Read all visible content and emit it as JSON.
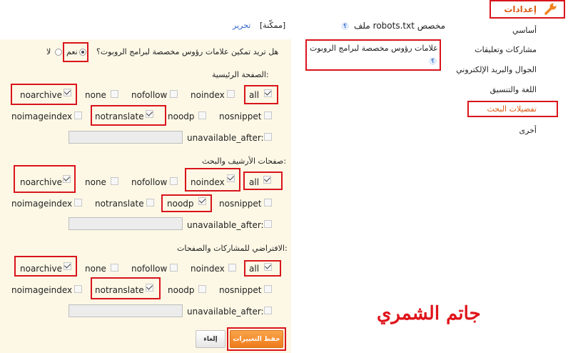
{
  "sidebar": {
    "items": [
      {
        "label": "إعدادات"
      },
      {
        "label": "أساسي"
      },
      {
        "label": "مشاركات وتعليقات"
      },
      {
        "label": "الجوال والبريد الإلكتروني"
      },
      {
        "label": "اللغة والتنسيق"
      },
      {
        "label": "تفضيلات البحث"
      },
      {
        "label": "أخرى"
      }
    ]
  },
  "robots_txt": {
    "title": "ملف robots.txt مخصص",
    "help": "؟",
    "status": "[ممكّنة]",
    "edit_link": "تحرير"
  },
  "robots_tags": {
    "title": "علامات رؤوس مخصصة لبرامج الروبوت",
    "help": "؟",
    "question": "هل تريد تمكين علامات رؤوس مخصصة لبرامج الروبوت؟",
    "yes_label": "نعم",
    "no_label": "لا"
  },
  "sections": [
    {
      "title": "الصفحة الرئيسية:",
      "row1": [
        "all",
        "noindex",
        "nofollow",
        "none",
        "noarchive"
      ],
      "row2": [
        "nosnippet",
        "noodp",
        "notranslate",
        "noimageindex"
      ],
      "row3": "unavailable_after:"
    },
    {
      "title": "صفحات الأرشيف والبحث:",
      "row1": [
        "all",
        "noindex",
        "nofollow",
        "none",
        "noarchive"
      ],
      "row2": [
        "nosnippet",
        "noodp",
        "notranslate",
        "noimageindex"
      ],
      "row3": "unavailable_after:"
    },
    {
      "title": "الافتراضي للمشاركات والصفحات:",
      "row1": [
        "all",
        "noindex",
        "nofollow",
        "none",
        "noarchive"
      ],
      "row2": [
        "nosnippet",
        "noodp",
        "notranslate",
        "noimageindex"
      ],
      "row3": "unavailable_after:"
    }
  ],
  "buttons": {
    "save": "حفظ التغييرات",
    "cancel": "إلغاء"
  },
  "watermark": "جاتم الشمري",
  "colors": {
    "accent": "#dd5a14",
    "highlight": "#d9141b",
    "panel": "#fdf8e6",
    "save_button": "#f58a2c"
  }
}
